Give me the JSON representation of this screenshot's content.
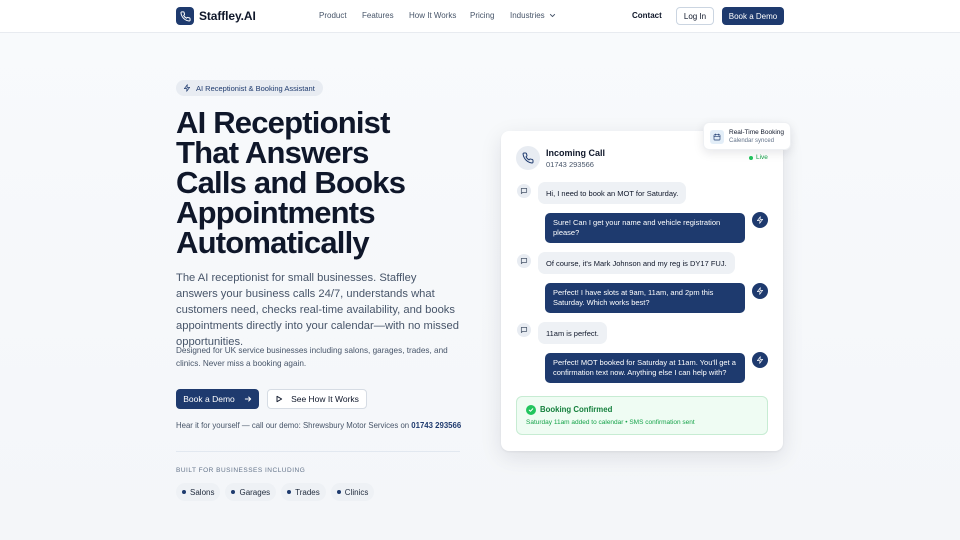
{
  "nav": {
    "brand": "Staffley.AI",
    "links": [
      "Product",
      "Features",
      "How It Works",
      "Pricing",
      "Industries"
    ],
    "contact": "Contact",
    "login": "Log In",
    "demo": "Book a Demo"
  },
  "hero": {
    "badge": "AI Receptionist & Booking Assistant",
    "title_lines": [
      "AI Receptionist",
      "That Answers",
      "Calls and Books",
      "Appointments",
      "Automatically"
    ],
    "subtitle": "The AI receptionist for small businesses. Staffley answers your business calls 24/7, understands what customers need, checks real-time availability, and books appointments directly into your calendar—with no missed opportunities.",
    "subtitle2": "Designed for UK service businesses including salons, garages, trades, and clinics. Never miss a booking again.",
    "primary_cta": "Book a Demo",
    "secondary_cta": "See How It Works",
    "demo_line_prefix": "Hear it for yourself — call our demo: Shrewsbury Motor Services on ",
    "demo_phone": "01743 293566",
    "built_label": "BUILT FOR BUSINESSES INCLUDING",
    "chips": [
      "Salons",
      "Garages",
      "Trades",
      "Clinics"
    ]
  },
  "call": {
    "title": "Incoming Call",
    "number": "01743 293566",
    "live": "Live",
    "floating_title": "Real-Time Booking",
    "floating_sub": "Calendar synced",
    "messages": [
      {
        "role": "customer",
        "text": "Hi, I need to book an MOT for Saturday."
      },
      {
        "role": "ai",
        "text": "Sure! Can I get your name and vehicle registration please?"
      },
      {
        "role": "customer",
        "text": "Of course, it's Mark Johnson and my reg is DY17 FUJ."
      },
      {
        "role": "ai",
        "text": "Perfect! I have slots at 9am, 11am, and 2pm this Saturday. Which works best?"
      },
      {
        "role": "customer",
        "text": "11am is perfect."
      },
      {
        "role": "ai",
        "text": "Perfect! MOT booked for Saturday at 11am. You'll get a confirmation text now. Anything else I can help with?"
      }
    ],
    "confirm_title": "Booking Confirmed",
    "confirm_sub": "Saturday 11am added to calendar • SMS confirmation sent"
  },
  "colors": {
    "brand": "#1e3a6e",
    "success": "#22c55e"
  }
}
